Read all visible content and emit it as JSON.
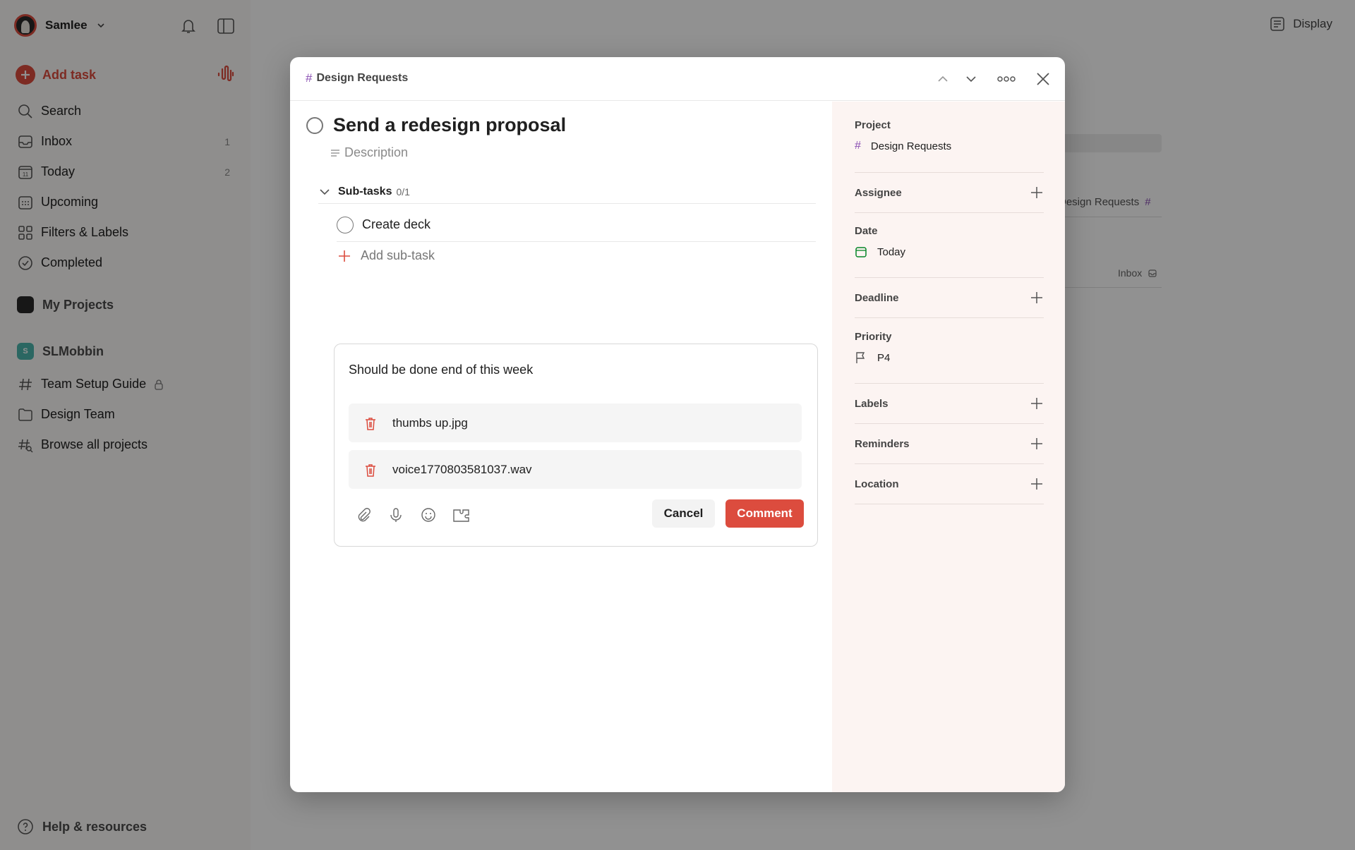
{
  "sidebar": {
    "account_name": "Samlee",
    "add_task": "Add task",
    "nav": [
      {
        "label": "Search",
        "count": ""
      },
      {
        "label": "Inbox",
        "count": "1"
      },
      {
        "label": "Today",
        "count": "2"
      },
      {
        "label": "Upcoming",
        "count": ""
      },
      {
        "label": "Filters & Labels",
        "count": ""
      },
      {
        "label": "Completed",
        "count": ""
      }
    ],
    "today_icon_day": "11",
    "my_projects": "My Projects",
    "workspace": {
      "badge": "S",
      "name": "SLMobbin"
    },
    "workspace_items": [
      {
        "label": "Team Setup Guide"
      },
      {
        "label": "Design Team"
      },
      {
        "label": "Browse all projects"
      }
    ],
    "help": "Help & resources"
  },
  "main": {
    "display": "Display",
    "bg_task_project": "Design Requests",
    "bg_task_project_hash": "#",
    "bg_inbox": "Inbox"
  },
  "modal": {
    "header_project": "Design Requests",
    "hash": "#",
    "task_title": "Send a redesign proposal",
    "description_placeholder": "Description",
    "subtasks": {
      "label": "Sub-tasks",
      "count": "0/1",
      "items": [
        {
          "title": "Create deck"
        }
      ],
      "add_label": "Add sub-task"
    },
    "comment": {
      "text": "Should be done end of this week",
      "attachments": [
        {
          "name": "thumbs up.jpg"
        },
        {
          "name": "voice1770803581037.wav"
        }
      ],
      "cancel": "Cancel",
      "submit": "Comment"
    }
  },
  "details": {
    "project_label": "Project",
    "project_value": "Design Requests",
    "assignee_label": "Assignee",
    "date_label": "Date",
    "date_value": "Today",
    "deadline_label": "Deadline",
    "priority_label": "Priority",
    "priority_value": "P4",
    "labels_label": "Labels",
    "reminders_label": "Reminders",
    "location_label": "Location"
  },
  "colors": {
    "accent": "#dc4c3e",
    "project_hash": "#8a4fb3",
    "date_green": "#058527",
    "panel_bg": "#fcf4f2"
  }
}
